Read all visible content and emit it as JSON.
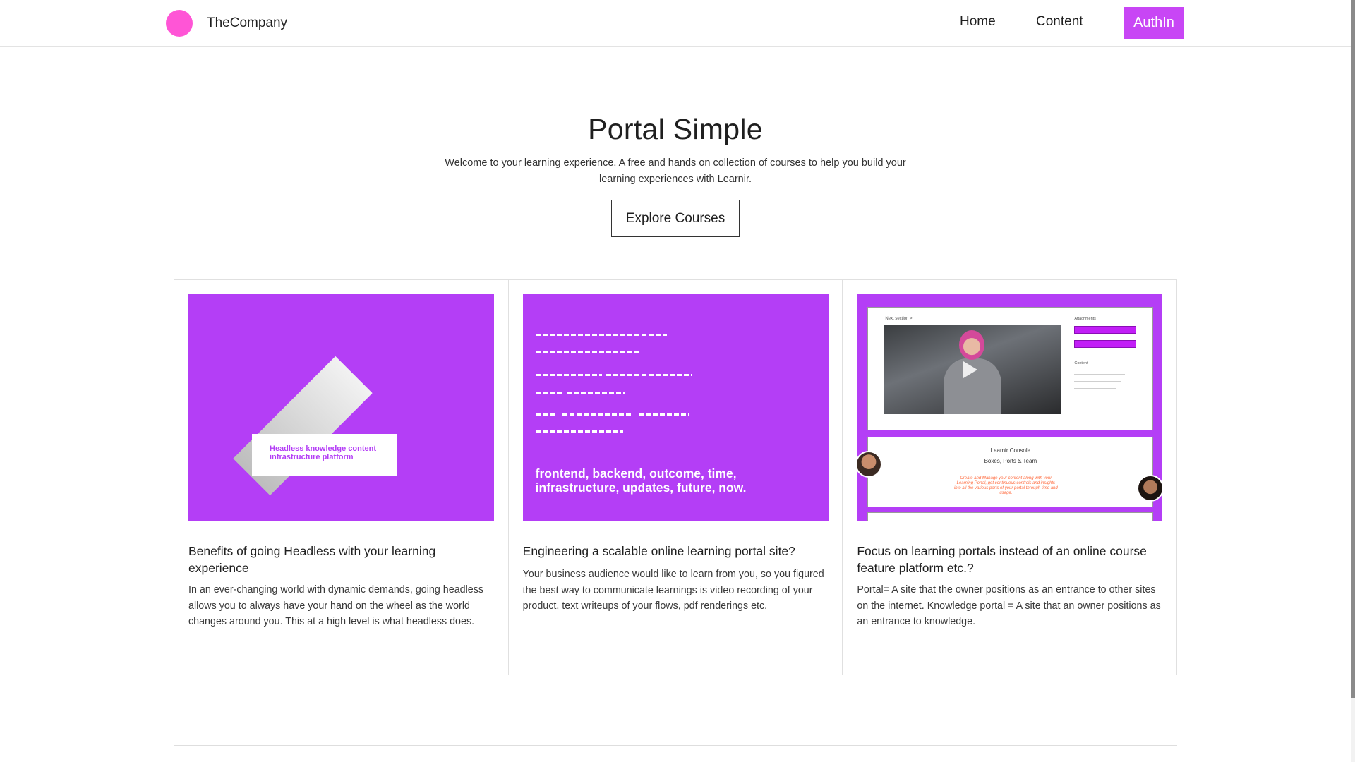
{
  "header": {
    "brand_name": "TheCompany",
    "nav": {
      "home": "Home",
      "content": "Content"
    },
    "auth_label": "AuthIn"
  },
  "hero": {
    "title": "Portal Simple",
    "subtitle": "Welcome to your learning experience. A free and hands on collection of courses to help you build your learning experiences with Learnir.",
    "cta": "Explore Courses"
  },
  "cards": [
    {
      "title": "Benefits of going Headless with your learning experience",
      "text": "In an ever-changing world with dynamic demands, going headless allows you to always have your hand on the wheel as the world changes around you. This at a high level is what headless does.",
      "art_label": "Headless knowledge content infrastructure platform"
    },
    {
      "title": "Engineering a scalable online learning portal site?",
      "text": "Your business audience would like to learn from you, so you figured the best way to communicate learnings is video recording of your product, text writeups of your flows, pdf renderings etc.",
      "art_keywords": "frontend, backend, outcome, time, infrastructure, updates, future, now."
    },
    {
      "title": "Focus on learning portals instead of an online course feature platform etc.?",
      "text": "Portal= A site that the owner positions as an entrance to other sites on the internet. Knowledge portal = A site that an owner positions as an entrance to knowledge.",
      "art": {
        "next_section": "Next section >",
        "attachments": "Attachments",
        "content": "Content",
        "console_title": "Learnir Console",
        "console_sub": "Boxes, Ports & Team",
        "console_desc": "Create and Manage your content along with your Learning Portal, get continuous controls and insights into all the various parts of your portal through time and usage."
      }
    }
  ],
  "colors": {
    "brand_logo": "#ff55d6",
    "accent": "#c846f5",
    "card_art": "#b43ef6"
  }
}
